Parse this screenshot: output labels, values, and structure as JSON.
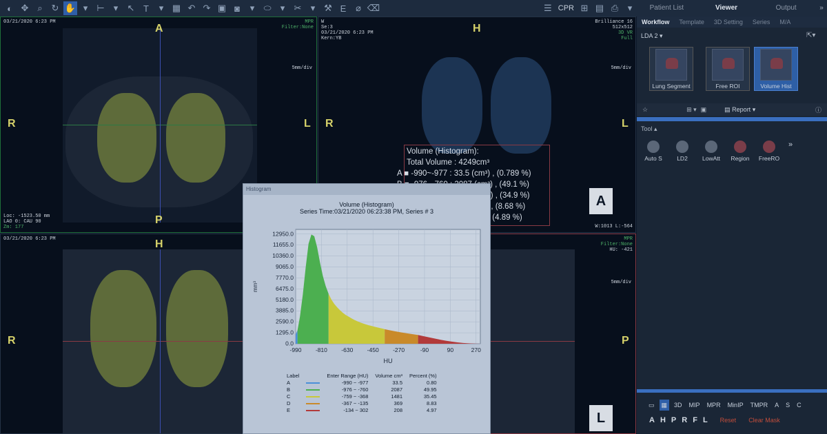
{
  "toolbar": {
    "cpr_label": "CPR"
  },
  "right_tabs": {
    "items": [
      "Patient List",
      "Viewer",
      "Output"
    ],
    "active": "Viewer"
  },
  "sub_tabs": {
    "items": [
      "Workflow",
      "Template",
      "3D Setting",
      "Series",
      "M/A"
    ],
    "active": "Workflow"
  },
  "lda_label": "LDA 2",
  "workflow": [
    "Lung Segment",
    "Free ROI",
    "Volume Hist"
  ],
  "report_label": "Report",
  "tool_header": "Tool",
  "tools": [
    "Auto S",
    "LD2",
    "LowAtt",
    "Region",
    "FreeRO"
  ],
  "view_modes": [
    "3D",
    "MIP",
    "MPR",
    "MinIP",
    "TMPR",
    "A",
    "S",
    "C"
  ],
  "bottom_bar": {
    "orient_buttons": [
      "A",
      "H",
      "P",
      "R",
      "F",
      "L"
    ],
    "reset": "Reset",
    "clear_mask": "Clear Mask"
  },
  "viewports": {
    "axial": {
      "date": "03/21/2020 6:23 PM",
      "type": "MPR",
      "filter": "Filter:None",
      "scale": "5mm/div",
      "loc": "Loc: -1523.50 mm",
      "angle": "LAO 0: CAU 90",
      "zoom": "Zm: 177",
      "orient": {
        "top": "A",
        "bottom": "P",
        "left": "R",
        "right": "L"
      }
    },
    "vr": {
      "line1": "W",
      "series": "Se:3",
      "date": "03/21/2020 6:23 PM",
      "kern": "Kern:YB",
      "scanner": "Brilliance 16",
      "matrix": "512x512",
      "mode": "3D VR",
      "quality": "Full",
      "scale": "5mm/div",
      "wl": "W:1013 L:-564",
      "orient": {
        "top": "H",
        "left": "R",
        "right": "L"
      },
      "cube_label": "A"
    },
    "coronal": {
      "date": "03/21/2020 6:23 PM",
      "orient": {
        "top": "H",
        "left": "R"
      }
    },
    "sagittal": {
      "type": "MPR",
      "filter": "Filter:None",
      "hu": "HU: -421",
      "scale": "5mm/div",
      "orient": {
        "right": "P"
      },
      "cube_label": "L"
    }
  },
  "annotation": {
    "title": "Volume (Histogram):",
    "total": "Total Volume : 4249cm³",
    "lines": [
      "A ■ -990~-977 : 33.5 (cm³) , (0.789 %)",
      "B ■ -976~-760 : 2087 (cm³) , (49.1 %)",
      "C ■ -759~-368 : 1481 (cm³) , (34.9 %)",
      "D ■ -367~-135 : 369 (cm³) , (8.68 %)",
      "E ■ -134~302 : 208 (cm³) , (4.89 %)"
    ]
  },
  "histogram_window": {
    "window_title": "Histogram",
    "chart_title": "Volume (Histogram)",
    "series_line": "Series Time:03/21/2020   06:23:38 PM, Series # 3",
    "table_headers": [
      "Label",
      "Enter Range (HU)",
      "Volume cm³",
      "Percent (%)"
    ],
    "rows": [
      {
        "label": "A",
        "range": "-990 ~  -977",
        "volume": "33.5",
        "percent": "0.80",
        "color": "#4a90d9"
      },
      {
        "label": "B",
        "range": "-976 ~  -760",
        "volume": "2087",
        "percent": "49.95",
        "color": "#4caf50"
      },
      {
        "label": "C",
        "range": "-759 ~  -368",
        "volume": "1481",
        "percent": "35.45",
        "color": "#c8c83a"
      },
      {
        "label": "D",
        "range": "-367 ~  -135",
        "volume": "369",
        "percent": "8.83",
        "color": "#c98a2a"
      },
      {
        "label": "E",
        "range": "-134 ~  302",
        "volume": "208",
        "percent": "4.97",
        "color": "#b23a3a"
      }
    ]
  },
  "chart_data": {
    "type": "area",
    "title": "",
    "xlabel": "HU",
    "ylabel": "mm³",
    "x_ticks": [
      -990,
      -810,
      -630,
      -450,
      -270,
      -90,
      90,
      270
    ],
    "y_ticks": [
      0.0,
      1295.0,
      2590.0,
      3885.0,
      5180.0,
      6475.0,
      7770.0,
      9065.0,
      10360.0,
      11655.0,
      12950.0
    ],
    "y_tick_labels": [
      "0.0",
      "1295.0",
      "2590.0",
      "3885.0",
      "5180.0",
      "6475.0",
      "7770.0",
      "9065.0",
      "10360.0",
      "11655.0",
      "12950.0"
    ],
    "xlim": [
      -990,
      300
    ],
    "ylim": [
      0,
      13500
    ],
    "x": [
      -990,
      -977,
      -960,
      -940,
      -920,
      -900,
      -880,
      -860,
      -840,
      -820,
      -800,
      -780,
      -760,
      -740,
      -720,
      -700,
      -680,
      -660,
      -640,
      -620,
      -600,
      -580,
      -560,
      -540,
      -520,
      -500,
      -480,
      -460,
      -440,
      -420,
      -400,
      -380,
      -368,
      -340,
      -300,
      -260,
      -220,
      -180,
      -135,
      -100,
      -60,
      -20,
      20,
      60,
      100,
      140,
      180,
      220,
      260,
      302
    ],
    "y": [
      1100,
      1600,
      3200,
      5800,
      9000,
      11800,
      12900,
      12700,
      11400,
      9600,
      8000,
      6800,
      5900,
      5200,
      4700,
      4300,
      3950,
      3650,
      3400,
      3200,
      3000,
      2820,
      2660,
      2520,
      2400,
      2290,
      2190,
      2100,
      2010,
      1930,
      1850,
      1780,
      1720,
      1620,
      1480,
      1360,
      1250,
      1150,
      1040,
      900,
      760,
      620,
      480,
      360,
      250,
      160,
      90,
      50,
      20,
      5
    ],
    "regions": [
      {
        "label": "A",
        "from": -990,
        "to": -977,
        "color": "#4a90d9"
      },
      {
        "label": "B",
        "from": -976,
        "to": -760,
        "color": "#4caf50"
      },
      {
        "label": "C",
        "from": -759,
        "to": -368,
        "color": "#c8c83a"
      },
      {
        "label": "D",
        "from": -367,
        "to": -135,
        "color": "#c98a2a"
      },
      {
        "label": "E",
        "from": -134,
        "to": 302,
        "color": "#b23a3a"
      }
    ]
  }
}
